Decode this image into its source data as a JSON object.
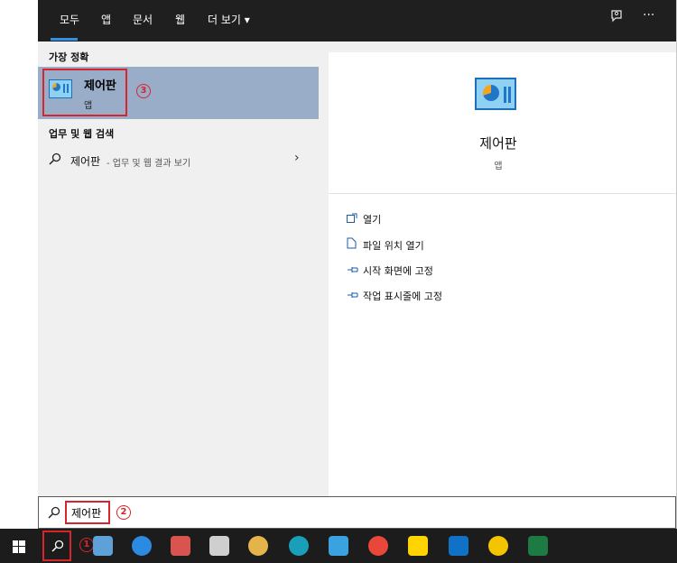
{
  "tabs": [
    "모두",
    "앱",
    "문서",
    "웹",
    "더 보기 ▾"
  ],
  "best_match_title": "가장 정확",
  "best_match": {
    "name": "제어판",
    "type": "앱"
  },
  "web_section_title": "업무 및 웹 검색",
  "web_result": {
    "query": "제어판",
    "suffix": " - 업무 및 웹 결과 보기"
  },
  "preview": {
    "name": "제어판",
    "type": "앱"
  },
  "actions": [
    {
      "label": "열기",
      "icon": "open-icon"
    },
    {
      "label": "파일 위치 열기",
      "icon": "file-location-icon"
    },
    {
      "label": "시작 화면에 고정",
      "icon": "pin-icon"
    },
    {
      "label": "작업 표시줄에 고정",
      "icon": "pin-icon"
    }
  ],
  "search": {
    "value": "제어판"
  },
  "markers": {
    "one": "1",
    "two": "2",
    "three": "3"
  },
  "colors": {
    "accent": "#2f8fe0",
    "highlight": "#99adc8",
    "annotation_red": "#d6262c"
  },
  "taskbar_icons": [
    "windows-start-icon",
    "search-icon",
    "task-view-icon",
    "internet-explorer-icon",
    "paint-icon",
    "notepad-icon",
    "art-icon",
    "edge-icon",
    "app-icon",
    "chrome-icon",
    "kakaotalk-icon",
    "outlook-icon",
    "app2-icon",
    "excel-icon"
  ]
}
